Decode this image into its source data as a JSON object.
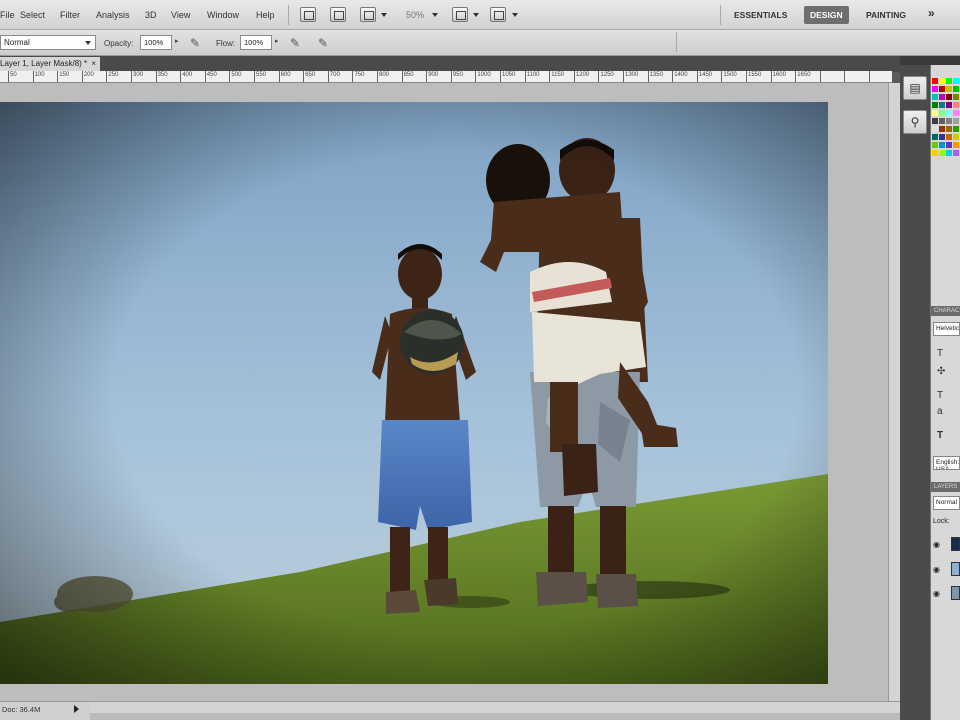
{
  "menu": {
    "items": [
      "File",
      "Select",
      "Filter",
      "Analysis",
      "3D",
      "View",
      "Window",
      "Help"
    ],
    "zoom": "50%"
  },
  "workspaces": {
    "essentials": "ESSENTIALS",
    "design": "DESIGN",
    "painting": "PAINTING",
    "more": "»"
  },
  "options": {
    "blend_mode": "Normal",
    "opacity_label": "Opacity:",
    "opacity_value": "100%",
    "flow_label": "Flow:",
    "flow_value": "100%"
  },
  "document": {
    "tab_title": "Layer 1, Layer Mask/8) *",
    "close": "×"
  },
  "ruler": {
    "labels": [
      "50",
      "100",
      "150",
      "200",
      "250",
      "300",
      "350",
      "400",
      "450",
      "500",
      "550",
      "600",
      "650",
      "700",
      "750",
      "800",
      "850",
      "900",
      "950",
      "1000",
      "1050",
      "1100",
      "1150",
      "1200",
      "1250",
      "1300",
      "1350",
      "1400",
      "1450",
      "1500",
      "1550",
      "1600",
      "1650"
    ]
  },
  "status": {
    "doc_info": "Doc: 36.4M"
  },
  "panels": {
    "character_header": "CHARACTER",
    "font_family": "Helvetica",
    "language": "English: USA",
    "layers_header": "LAYERS",
    "layer_blend": "Normal",
    "lock_label": "Lock:"
  },
  "colors": {
    "accent": "#6e6e6e",
    "menubar": "#dcdcdc",
    "canvas_bg": "#bdbdbd",
    "sky": "#8fb0cc",
    "grass": "#6f8f2e"
  }
}
